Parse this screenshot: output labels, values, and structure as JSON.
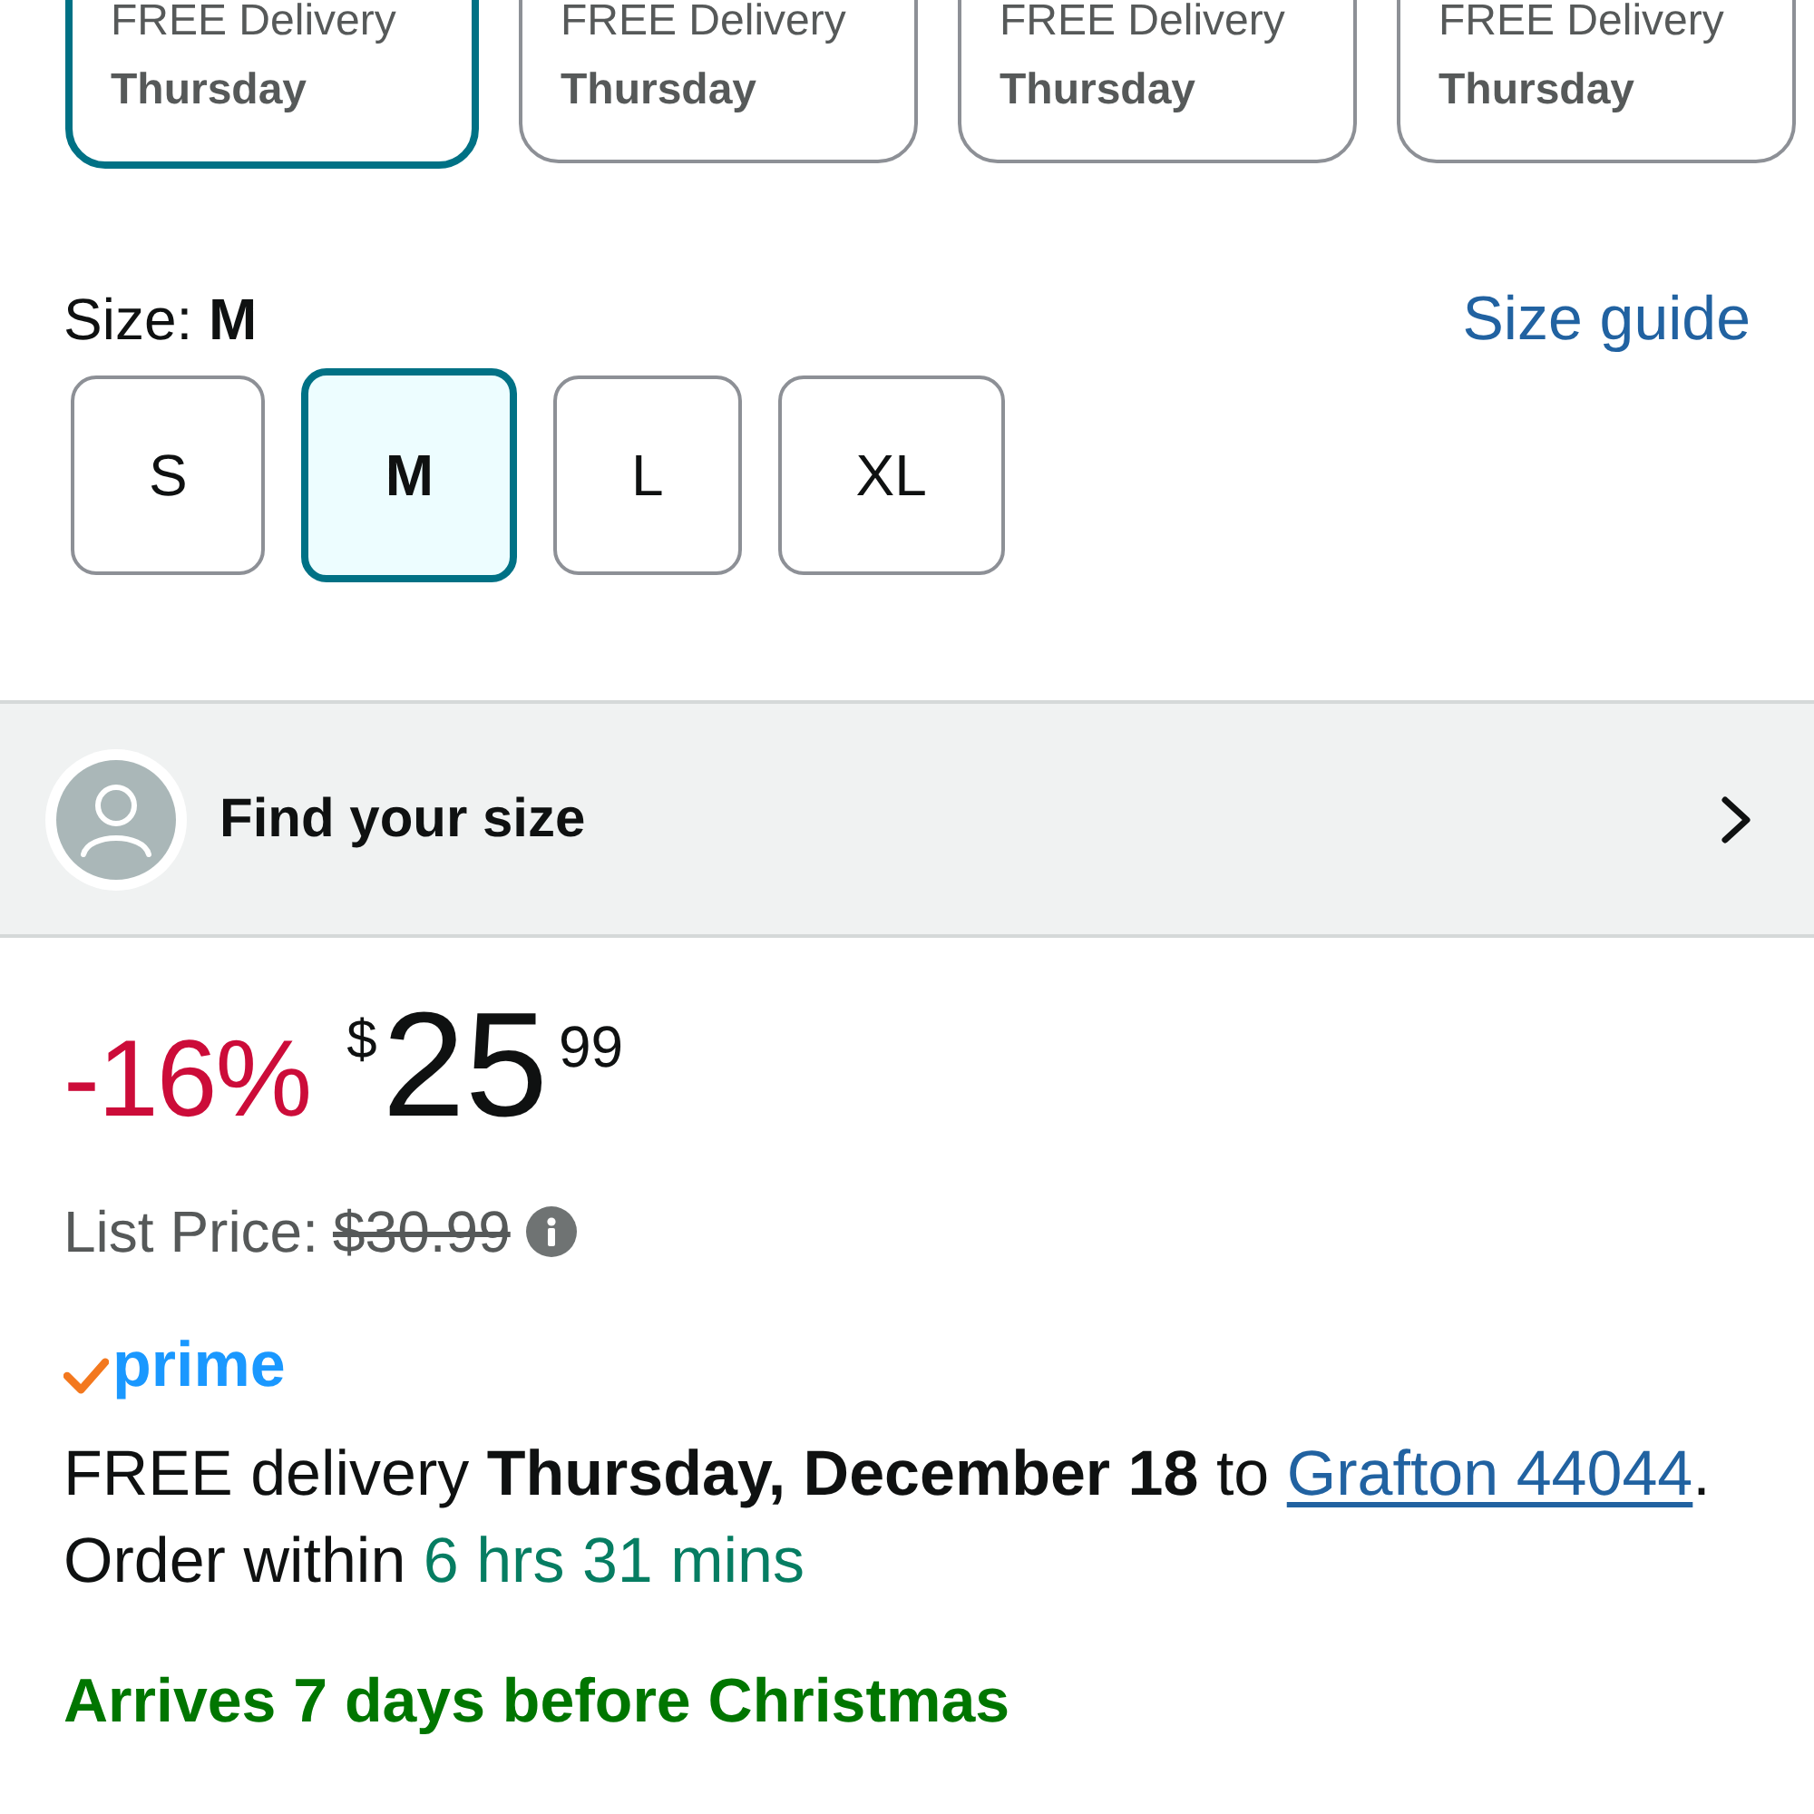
{
  "delivery_options": [
    {
      "line_1": "FREE Delivery",
      "line_2": "Thursday",
      "selected": true
    },
    {
      "line_1": "FREE Delivery",
      "line_2": "Thursday",
      "selected": false
    },
    {
      "line_1": "FREE Delivery",
      "line_2": "Thursday",
      "selected": false
    },
    {
      "line_1": "FREE Delivery",
      "line_2": "Thursday",
      "selected": false
    }
  ],
  "size": {
    "label": "Size: **M**",
    "guide_link": "Size guide",
    "options": [
      {
        "label": "S",
        "selected": false
      },
      {
        "label": "M",
        "selected": true
      },
      {
        "label": "L",
        "selected": false
      },
      {
        "label": "XL",
        "selected": false
      }
    ]
  },
  "find_your_size": {
    "label": "Find your size"
  },
  "price": {
    "discount": "-16%",
    "currency": "$",
    "whole": "25",
    "fraction": "99",
    "list_price_label": "List Price:",
    "list_price": "$30.99"
  },
  "prime": {
    "logo_text": "prime"
  },
  "delivery": {
    "text": "FREE delivery **Thursday, December 18** to",
    "location": "Grafton 44044",
    "after_location": ". Order within",
    "countdown": "6 hrs 31 mins"
  },
  "arrival_note": "Arrives 7 days before Christmas"
}
